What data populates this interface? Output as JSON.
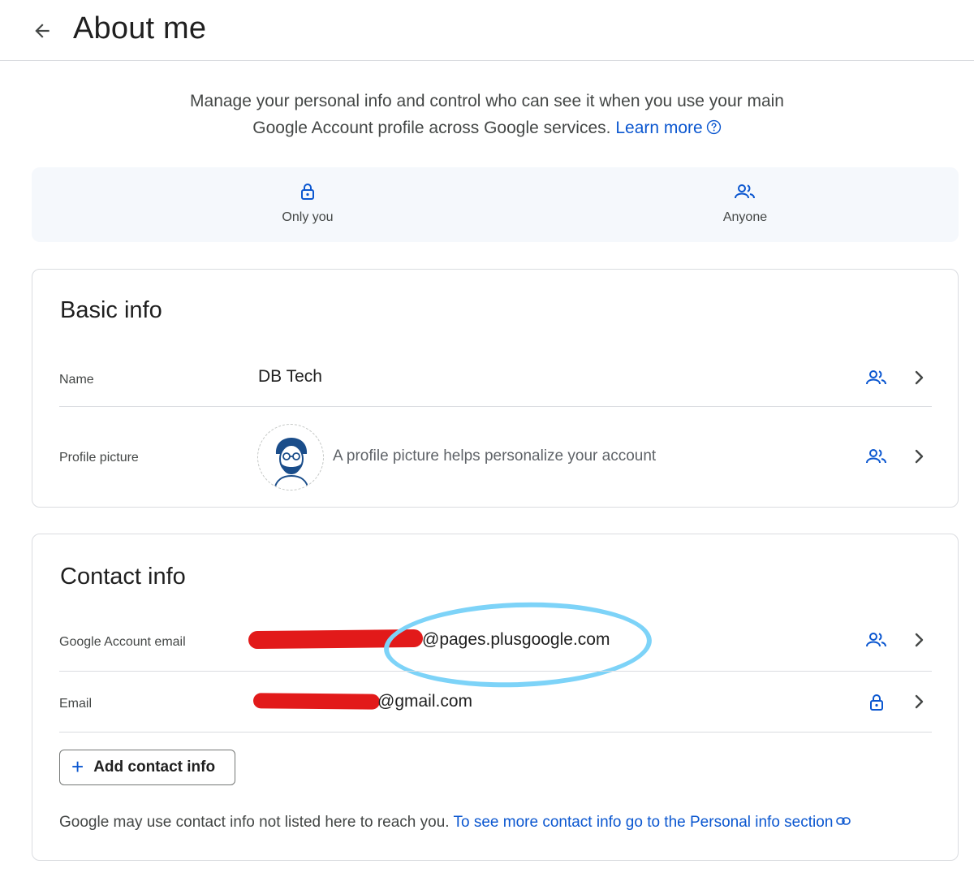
{
  "header": {
    "title": "About me",
    "back_icon": "arrow-back-icon"
  },
  "intro": {
    "line1": "Manage your personal info and control who can see it when you use your main",
    "line2": "Google Account profile across Google services.",
    "learn_more": "Learn more",
    "help_icon": "help-circle-icon"
  },
  "legend": {
    "only_you": {
      "label": "Only you",
      "icon": "lock-icon"
    },
    "anyone": {
      "label": "Anyone",
      "icon": "people-icon"
    }
  },
  "basic_info": {
    "title": "Basic info",
    "rows": [
      {
        "label": "Name",
        "value": "DB Tech",
        "visibility_icon": "people-icon"
      },
      {
        "label": "Profile picture",
        "hint": "A profile picture helps personalize your account",
        "visibility_icon": "people-icon"
      }
    ]
  },
  "contact_info": {
    "title": "Contact info",
    "rows": [
      {
        "label": "Google Account email",
        "value": "@pages.plusgoogle.com",
        "visibility_icon": "people-icon"
      },
      {
        "label": "Email",
        "value": "@gmail.com",
        "visibility_icon": "lock-icon"
      }
    ],
    "add_button": "Add contact info",
    "footnote_text": "Google may use contact info not listed here to reach you.",
    "footnote_link": "To see more contact info go to the Personal info section"
  },
  "colors": {
    "accent": "#0b57d0",
    "redaction": "#e21a1a",
    "highlight_oval": "#7dd3f8",
    "legend_bg": "#f5f8fc",
    "border": "#dadce0"
  }
}
